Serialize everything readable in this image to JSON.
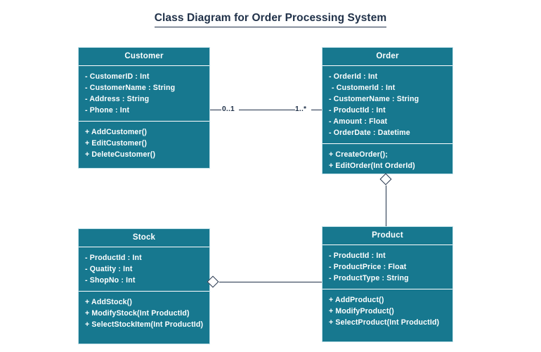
{
  "title": {
    "text": "Class Diagram for Order Processing System"
  },
  "theme": {
    "box_fill": "#17788f",
    "box_border": "#bfe0e8",
    "box_text": "#ffffff",
    "line_color": "#1f3048",
    "title_color": "#1f3048",
    "background": "#ffffff"
  },
  "classes": {
    "customer": {
      "name": "Customer",
      "attributes": [
        "- CustomerID : Int",
        "- CustomerName : String",
        "- Address : String",
        "- Phone : Int"
      ],
      "methods": [
        "+ AddCustomer()",
        "+ EditCustomer()",
        "+ DeleteCustomer()"
      ]
    },
    "order": {
      "name": "Order",
      "attributes": [
        "- OrderId : Int",
        "- CustomerId : Int",
        "- CustomerName : String",
        "- ProductId : Int",
        "- Amount : Float",
        "- OrderDate : Datetime"
      ],
      "methods": [
        "+ CreateOrder();",
        "+ EditOrder(Int OrderId)"
      ]
    },
    "stock": {
      "name": "Stock",
      "attributes": [
        "- ProductId : Int",
        "- Quatity : Int",
        "- ShopNo : Int"
      ],
      "methods": [
        "+ AddStock()",
        "+ ModifyStock(Int ProductId)",
        "+ SelectStockItem(Int ProductId)"
      ]
    },
    "product": {
      "name": "Product",
      "attributes": [
        "- ProductId : Int",
        "- ProductPrice : Float",
        "- ProductType : String"
      ],
      "methods": [
        "+ AddProduct()",
        "+ ModifyProduct()",
        "+ SelectProduct(Int ProductId)"
      ]
    }
  },
  "relationships": {
    "customer_order": {
      "type": "association",
      "source_multiplicity": "0..1",
      "target_multiplicity": "1..*"
    },
    "order_product": {
      "type": "aggregation",
      "diamond_end": "order"
    },
    "stock_product": {
      "type": "aggregation",
      "diamond_end": "stock"
    }
  }
}
